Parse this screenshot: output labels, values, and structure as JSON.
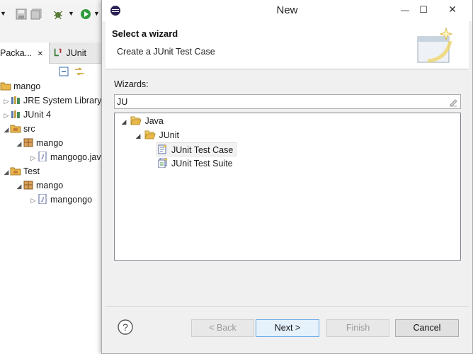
{
  "ide": {
    "view_tabs": [
      {
        "label": "Packa...",
        "close": "✕"
      },
      {
        "label": "JUnit"
      }
    ],
    "tree": [
      {
        "label": "mango",
        "expander": ""
      },
      {
        "label": "JRE System Library",
        "expander": "▷"
      },
      {
        "label": "JUnit 4",
        "expander": "▷"
      },
      {
        "label": "src",
        "expander": "◢"
      },
      {
        "label": "mango",
        "expander": "◢"
      },
      {
        "label": "mangogo.java",
        "expander": "▷"
      },
      {
        "label": "Test",
        "expander": "◢"
      },
      {
        "label": "mango",
        "expander": "◢"
      },
      {
        "label": "mangongo",
        "expander": "▷"
      }
    ]
  },
  "dialog": {
    "title": "New",
    "window_controls": {
      "minimize": "—",
      "maximize": "☐",
      "close": "✕"
    },
    "banner": {
      "title": "Select a wizard",
      "description": "Create a JUnit Test Case"
    },
    "wizards_label": "Wizards:",
    "filter": {
      "value": "JU",
      "placeholder": ""
    },
    "tree": [
      {
        "label": "Java",
        "expander": "◢",
        "icon": "folder-open-icon"
      },
      {
        "label": "JUnit",
        "expander": "◢",
        "icon": "folder-open-icon"
      },
      {
        "label": "JUnit Test Case",
        "expander": "",
        "icon": "junit-test-case-icon",
        "selected": true
      },
      {
        "label": "JUnit Test Suite",
        "expander": "",
        "icon": "junit-test-suite-icon"
      }
    ],
    "buttons": {
      "help": "?",
      "back": "< Back",
      "next": "Next >",
      "finish": "Finish",
      "cancel": "Cancel"
    }
  },
  "colors": {
    "folder": "#e8b84a",
    "package": "#c87d3a",
    "selection": "#f2f2f2",
    "default_button_border": "#6aa9e6"
  }
}
